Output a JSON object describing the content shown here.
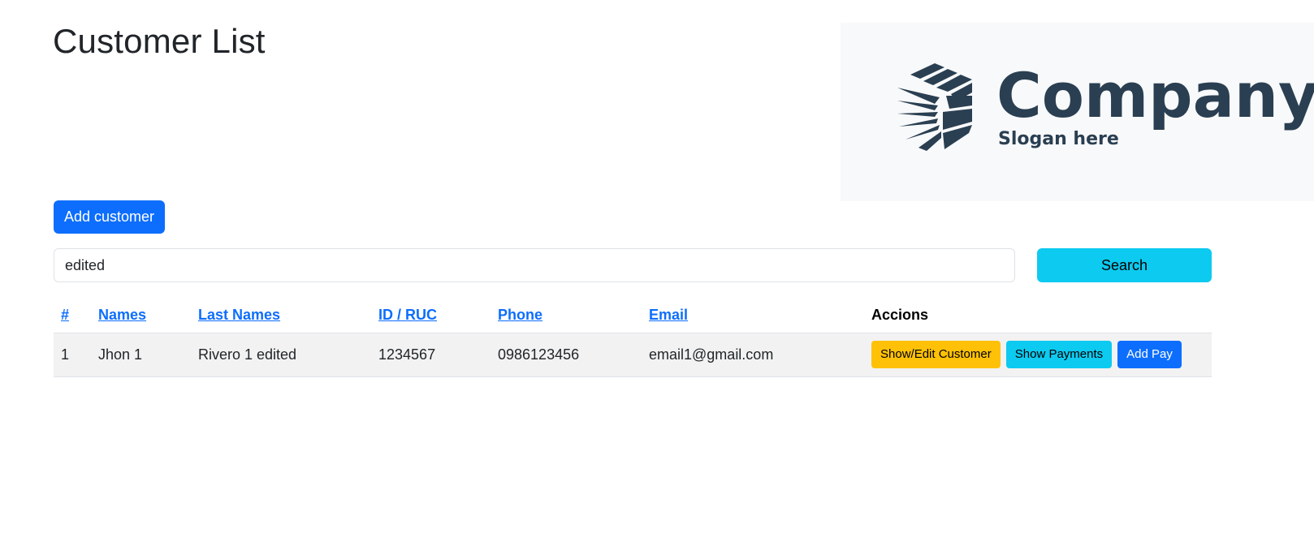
{
  "page": {
    "title": "Customer List"
  },
  "logo": {
    "name": "Company",
    "slogan": "Slogan here",
    "color": "#2a3f51"
  },
  "toolbar": {
    "add_customer_label": "Add customer",
    "search_value": "edited",
    "search_label": "Search"
  },
  "table": {
    "headers": {
      "num": "#",
      "names": "Names",
      "last_names": "Last Names",
      "id_ruc": "ID / RUC",
      "phone": "Phone",
      "email": "Email",
      "actions": "Accions"
    },
    "rows": [
      {
        "num": "1",
        "names": "Jhon 1",
        "last_names": "Rivero 1 edited",
        "id_ruc": "1234567",
        "phone": "0986123456",
        "email": "email1@gmail.com",
        "actions": {
          "show_edit": "Show/Edit Customer",
          "show_payments": "Show Payments",
          "add_pay": "Add Pay"
        }
      }
    ]
  },
  "colors": {
    "primary": "#0d6efd",
    "info": "#0dcaf0",
    "warning": "#ffc107"
  }
}
